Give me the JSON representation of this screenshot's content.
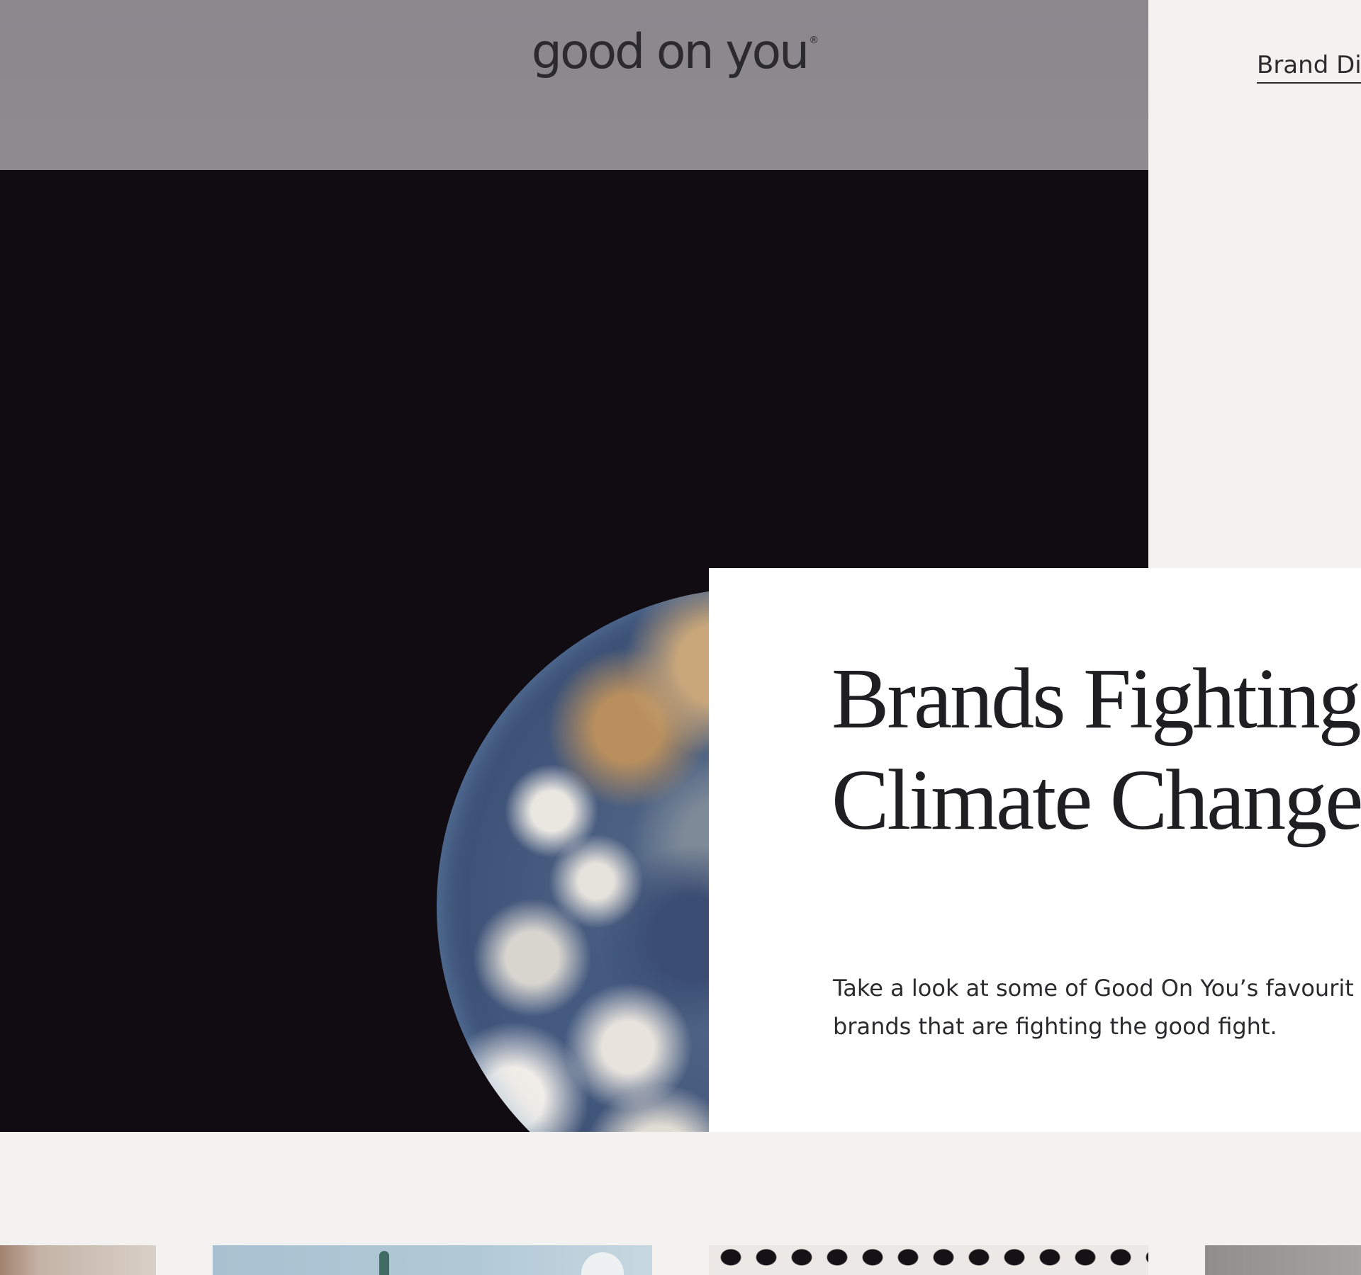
{
  "header": {
    "logo_text": "good on you",
    "logo_mark": "®"
  },
  "nav": {
    "brand_directory_label": "Brand Dir"
  },
  "hero": {
    "image_subject": "earth-from-space",
    "title_line1": "Brands Fighting",
    "title_line2": "Climate Change",
    "description": "Take a look at some of Good On You’s favourit brands that are fighting the good fight."
  },
  "colors": {
    "header_bg": "#8c898f",
    "page_bg": "#f3f2f0",
    "hero_bg": "#100c12",
    "card_bg": "#ffffff",
    "text": "#1f1e20"
  },
  "tiles": [
    {
      "subject": "portrait"
    },
    {
      "subject": "sky-landscape"
    },
    {
      "subject": "polka-dot-fabric"
    },
    {
      "subject": "grey-photo"
    }
  ]
}
